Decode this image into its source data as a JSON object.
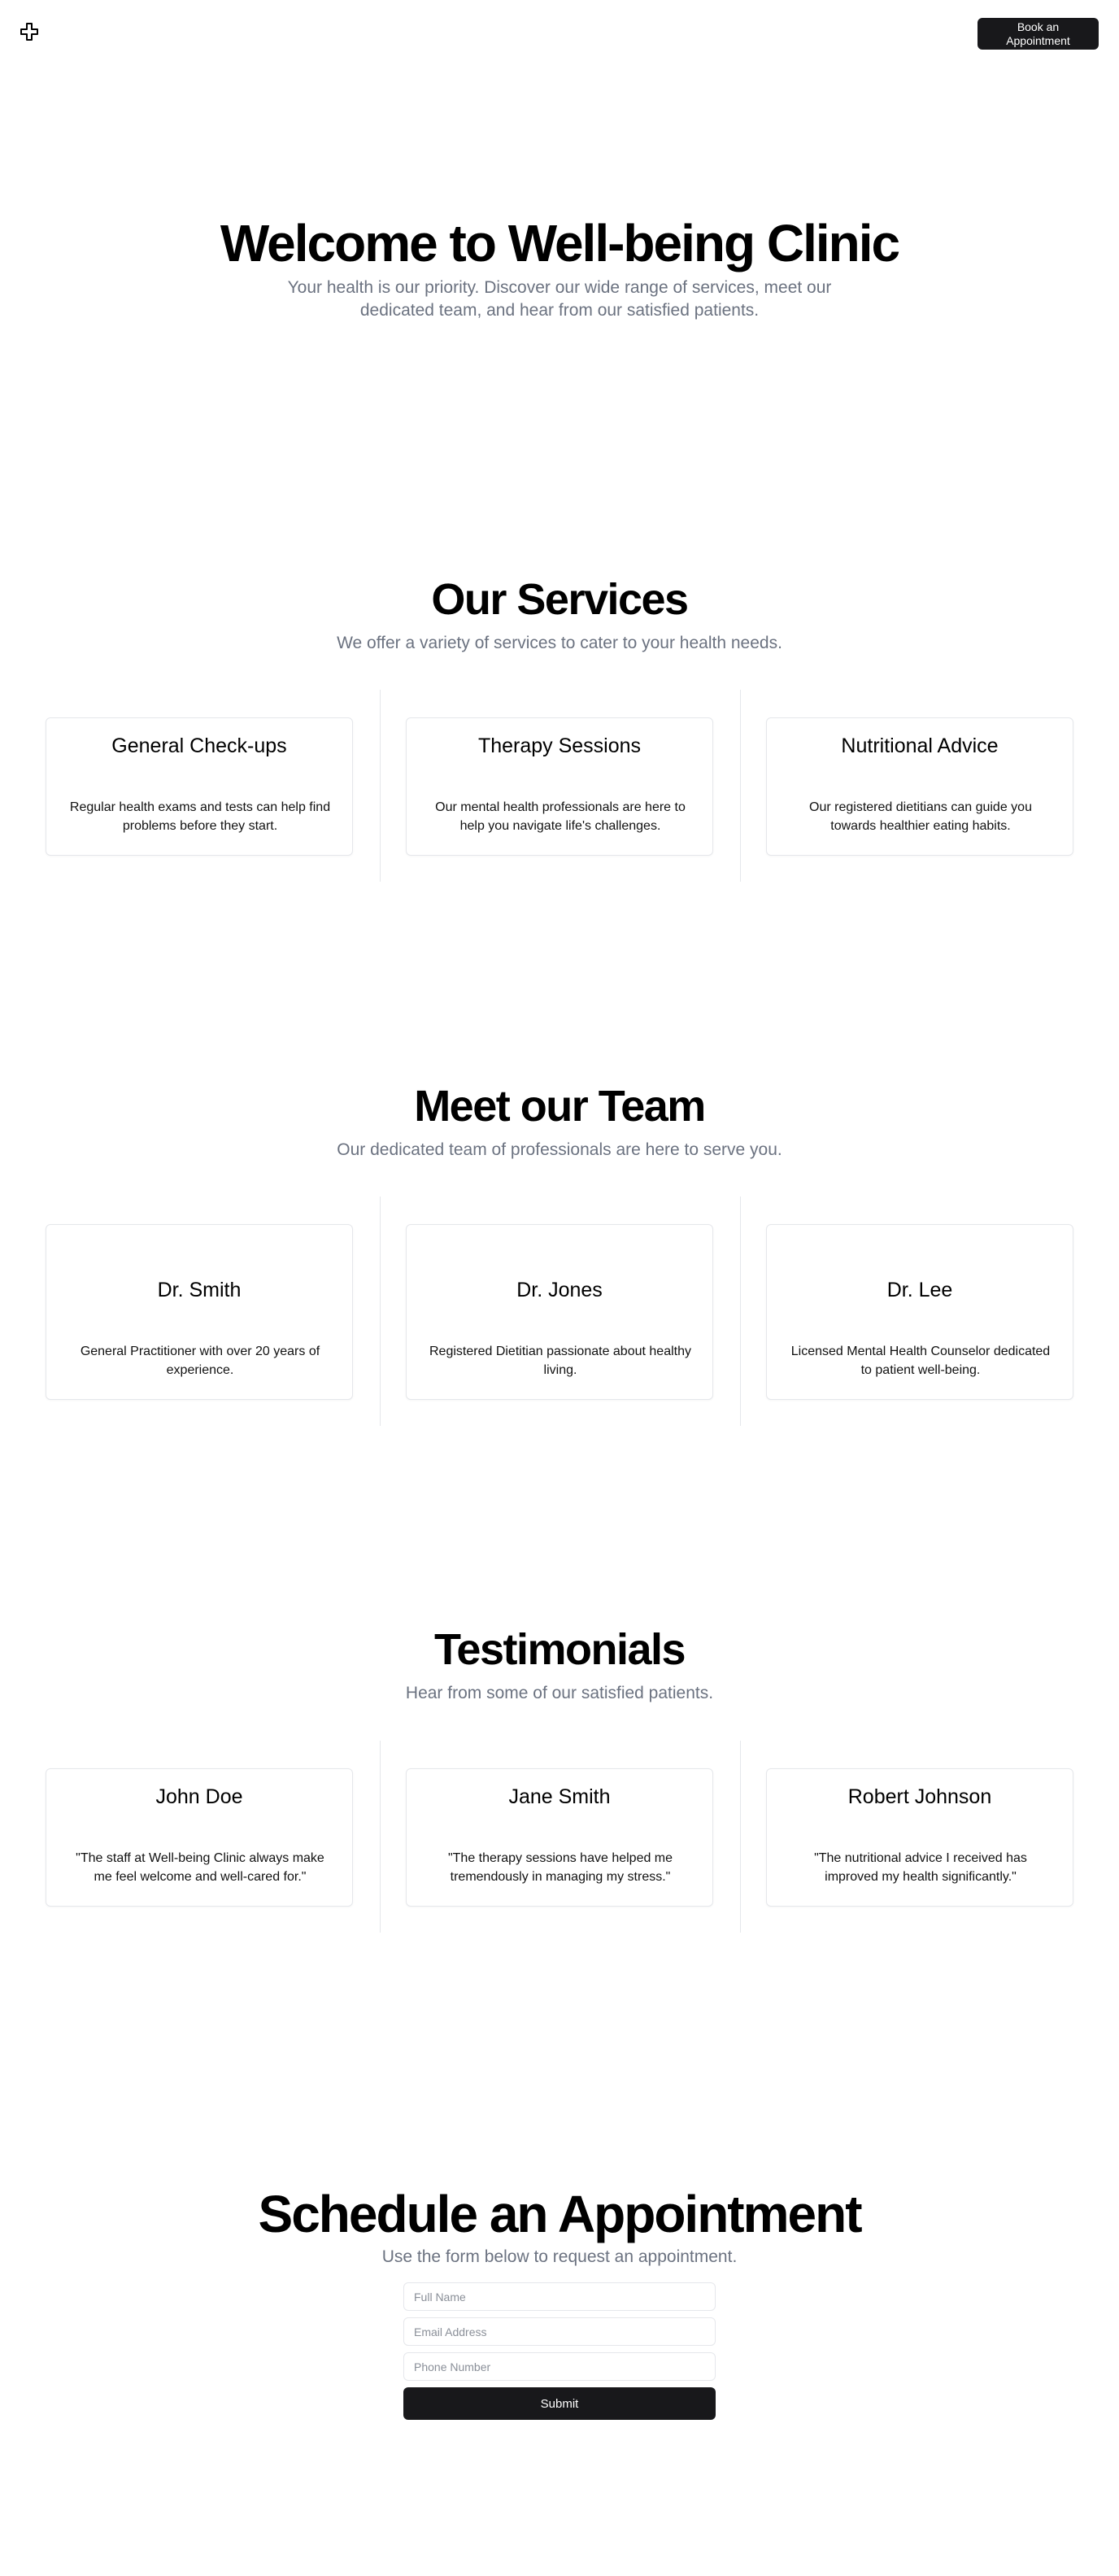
{
  "header": {
    "logo_icon": "medical-cross-icon",
    "book_button_label": "Book an Appointment"
  },
  "hero": {
    "title": "Welcome to Well-being Clinic",
    "subtitle": "Your health is our priority. Discover our wide range of services, meet our dedicated team, and hear from our satisfied patients."
  },
  "services": {
    "title": "Our Services",
    "subtitle": "We offer a variety of services to cater to your health needs.",
    "items": [
      {
        "title": "General Check-ups",
        "text": "Regular health exams and tests can help find problems before they start."
      },
      {
        "title": "Therapy Sessions",
        "text": "Our mental health professionals are here to help you navigate life's challenges."
      },
      {
        "title": "Nutritional Advice",
        "text": "Our registered dietitians can guide you towards healthier eating habits."
      }
    ]
  },
  "team": {
    "title": "Meet our Team",
    "subtitle": "Our dedicated team of professionals are here to serve you.",
    "items": [
      {
        "name": "Dr. Smith",
        "text": "General Practitioner with over 20 years of experience."
      },
      {
        "name": "Dr. Jones",
        "text": "Registered Dietitian passionate about healthy living."
      },
      {
        "name": "Dr. Lee",
        "text": "Licensed Mental Health Counselor dedicated to patient well-being."
      }
    ]
  },
  "testimonials": {
    "title": "Testimonials",
    "subtitle": "Hear from some of our satisfied patients.",
    "items": [
      {
        "name": "John Doe",
        "text": "\"The staff at Well-being Clinic always make me feel welcome and well-cared for.\""
      },
      {
        "name": "Jane Smith",
        "text": "\"The therapy sessions have helped me tremendously in managing my stress.\""
      },
      {
        "name": "Robert Johnson",
        "text": "\"The nutritional advice I received has improved my health significantly.\""
      }
    ]
  },
  "appointment": {
    "title": "Schedule an Appointment",
    "subtitle": "Use the form below to request an appointment.",
    "name_placeholder": "Full Name",
    "email_placeholder": "Email Address",
    "phone_placeholder": "Phone Number",
    "submit_label": "Submit"
  }
}
